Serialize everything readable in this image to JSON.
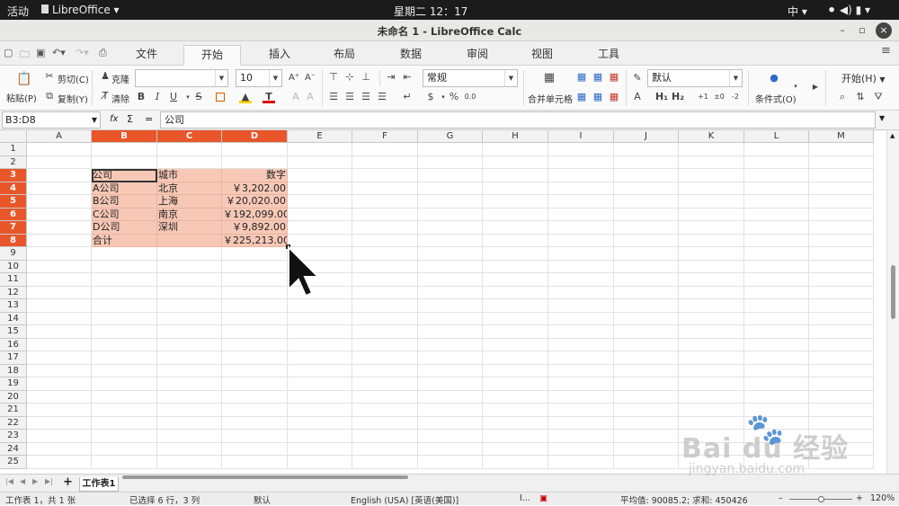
{
  "system": {
    "activities": "活动",
    "app_menu": "LibreOffice ▾",
    "clock": "星期二 12：17",
    "ime": "中 ▾",
    "tray": "⚫ ◀) ▮ ▾"
  },
  "window": {
    "title": "未命名 1 - LibreOffice Calc",
    "min": "–",
    "max": "▫",
    "close": "×"
  },
  "tabs": [
    "文件",
    "开始",
    "插入",
    "布局",
    "数据",
    "审阅",
    "视图",
    "工具"
  ],
  "active_tab": "开始",
  "ribbon": {
    "paste": "粘贴(P)",
    "cut": "剪切(C)",
    "copy": "复制(Y)",
    "clone": "克隆",
    "clear": "清除",
    "font_name": "",
    "font_size": "10",
    "number_format": "常规",
    "merge": "合并单元格",
    "cell_style": "默认",
    "conditional": "条件式(O)",
    "start_menu": "开始(H)",
    "bold": "B",
    "italic": "I",
    "underline": "U",
    "strike": "S",
    "percent": "%",
    "currency": "$",
    "dec1": "0.0",
    "inc_dec": "+1",
    "zero_dec": "±0",
    "dec_dec": "-2"
  },
  "formula_bar": {
    "name_box": "B3:D8",
    "fx": "fx",
    "sum": "Σ",
    "eq": "=",
    "content": "公司"
  },
  "columns": [
    "A",
    "B",
    "C",
    "D",
    "E",
    "F",
    "G",
    "H",
    "I",
    "J",
    "K",
    "L",
    "M"
  ],
  "selected_columns": [
    "B",
    "C",
    "D"
  ],
  "rows": [
    "1",
    "2",
    "3",
    "4",
    "5",
    "6",
    "7",
    "8",
    "9",
    "10",
    "11",
    "12",
    "13",
    "14",
    "15",
    "16",
    "17",
    "18",
    "19",
    "20",
    "21",
    "22",
    "23",
    "24",
    "25"
  ],
  "selected_rows": [
    "3",
    "4",
    "5",
    "6",
    "7",
    "8"
  ],
  "table": [
    [
      "公司",
      "城市",
      "数字"
    ],
    [
      "A公司",
      "北京",
      "￥3,202.00"
    ],
    [
      "B公司",
      "上海",
      "￥20,020.00"
    ],
    [
      "C公司",
      "南京",
      "￥192,099.00"
    ],
    [
      "D公司",
      "深圳",
      "￥9,892.00"
    ],
    [
      "合计",
      "",
      "￥225,213.00"
    ]
  ],
  "sheet": {
    "tab": "工作表1",
    "add": "+"
  },
  "status": {
    "sheet_info": "工作表 1，共 1 张",
    "selection": "已选择 6 行，3 列",
    "style": "默认",
    "language": "English (USA) [英语(美国)]",
    "insert": "I...",
    "stats": "平均值: 90085.2; 求和: 450426",
    "zoom": "120%"
  },
  "watermark": {
    "brand": "Bai du 经验",
    "url": "jingyan.baidu.com"
  }
}
